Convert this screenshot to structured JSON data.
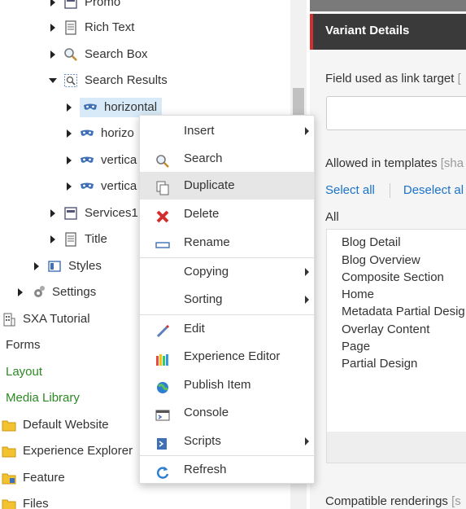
{
  "tree": {
    "items": [
      {
        "label": "Promo",
        "icon": "layout-icon"
      },
      {
        "label": "Rich Text",
        "icon": "document-icon"
      },
      {
        "label": "Search Box",
        "icon": "magnifier-icon"
      },
      {
        "label": "Search Results",
        "icon": "search-results-icon"
      },
      {
        "label": "horizontal",
        "icon": "variant-mask-icon"
      },
      {
        "label": "horizo",
        "icon": "variant-mask-icon"
      },
      {
        "label": "vertica",
        "icon": "variant-mask-icon"
      },
      {
        "label": "vertica",
        "icon": "variant-mask-icon"
      },
      {
        "label": "Services1",
        "icon": "layout-icon"
      },
      {
        "label": "Title",
        "icon": "document-icon"
      },
      {
        "label": "Styles",
        "icon": "styles-icon"
      },
      {
        "label": "Settings",
        "icon": "gear-icon"
      },
      {
        "label": "SXA Tutorial",
        "icon": "building-icon"
      },
      {
        "label": "Forms",
        "icon": "none"
      },
      {
        "label": "Layout",
        "icon": "none"
      },
      {
        "label": "Media Library",
        "icon": "none"
      },
      {
        "label": "Default Website",
        "icon": "folder-icon"
      },
      {
        "label": "Experience Explorer",
        "icon": "folder-icon"
      },
      {
        "label": "Feature",
        "icon": "folder-icon"
      },
      {
        "label": "Files",
        "icon": "folder-icon"
      }
    ]
  },
  "context_menu": {
    "items": [
      {
        "label": "Insert",
        "icon": "none",
        "submenu": true
      },
      {
        "label": "Search",
        "icon": "search-icon",
        "submenu": false
      },
      {
        "label": "Duplicate",
        "icon": "duplicate-icon",
        "submenu": false
      },
      {
        "label": "Delete",
        "icon": "delete-icon",
        "submenu": false
      },
      {
        "label": "Rename",
        "icon": "rename-icon",
        "submenu": false
      },
      {
        "label": "Copying",
        "icon": "none",
        "submenu": true
      },
      {
        "label": "Sorting",
        "icon": "none",
        "submenu": true
      },
      {
        "label": "Edit",
        "icon": "edit-icon",
        "submenu": false
      },
      {
        "label": "Experience Editor",
        "icon": "experience-editor-icon",
        "submenu": false
      },
      {
        "label": "Publish Item",
        "icon": "publish-icon",
        "submenu": false
      },
      {
        "label": "Console",
        "icon": "console-icon",
        "submenu": false
      },
      {
        "label": "Scripts",
        "icon": "scripts-icon",
        "submenu": true
      },
      {
        "label": "Refresh",
        "icon": "refresh-icon",
        "submenu": false
      }
    ],
    "highlighted": "Duplicate"
  },
  "details": {
    "header": "Variant Details",
    "link_target_label": "Field used as link target",
    "link_target_hint": "[",
    "link_target_value": "",
    "allowed_label": "Allowed in templates",
    "allowed_hint": "[sha",
    "select_all": "Select all",
    "deselect_all": "Deselect al",
    "all_label": "All",
    "templates": [
      "Blog Detail",
      "Blog Overview",
      "Composite Section",
      "Home",
      "Metadata Partial Desig",
      "Overlay Content",
      "Page",
      "Partial Design"
    ],
    "compat_label": "Compatible renderings",
    "compat_hint": "[s"
  },
  "colors": {
    "accent_red": "#d32f2f",
    "link_blue": "#1a73c9",
    "green_text": "#2b8a22",
    "header_dark": "#3a3a3a",
    "selection": "#d8eaf7"
  }
}
